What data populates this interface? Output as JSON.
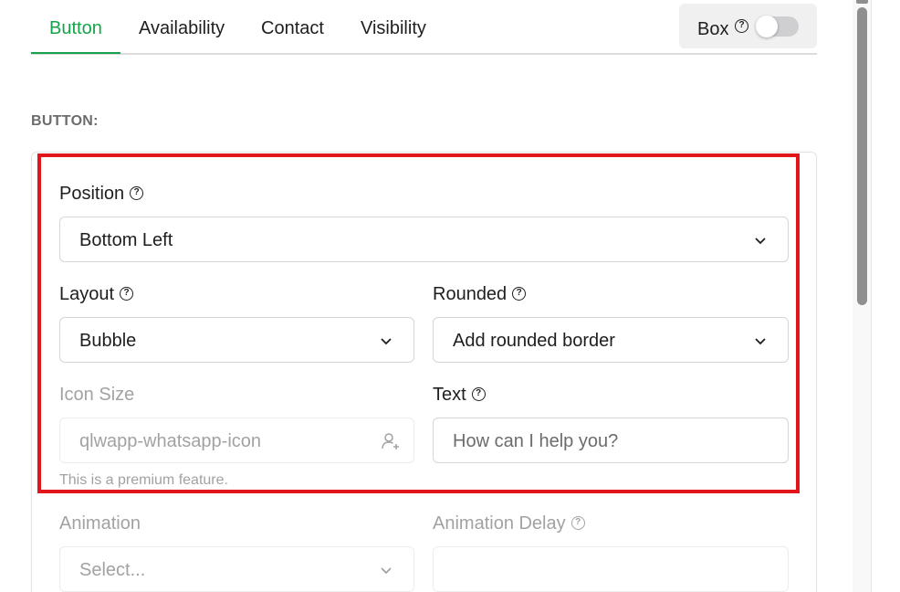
{
  "tabs": [
    {
      "label": "Button",
      "active": true
    },
    {
      "label": "Availability",
      "active": false
    },
    {
      "label": "Contact",
      "active": false
    },
    {
      "label": "Visibility",
      "active": false
    }
  ],
  "box_toggle": {
    "label": "Box",
    "enabled": false
  },
  "section": {
    "title": "BUTTON:"
  },
  "fields": {
    "position": {
      "label": "Position",
      "value": "Bottom Left"
    },
    "layout": {
      "label": "Layout",
      "value": "Bubble"
    },
    "rounded": {
      "label": "Rounded",
      "value": "Add rounded border"
    },
    "icon_size": {
      "label": "Icon Size",
      "placeholder": "qlwapp-whatsapp-icon",
      "note": "This is a premium feature."
    },
    "text": {
      "label": "Text",
      "placeholder": "How can I help you?"
    },
    "animation": {
      "label": "Animation",
      "placeholder": "Select..."
    },
    "animation_delay": {
      "label": "Animation Delay",
      "value": ""
    }
  },
  "colors": {
    "accent": "#14a34a",
    "highlight": "#e0161b"
  }
}
